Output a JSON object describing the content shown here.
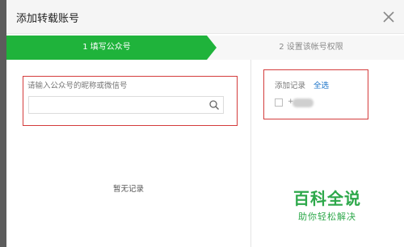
{
  "dialog": {
    "title": "添加转载账号",
    "close_icon": "close-icon"
  },
  "steps": [
    {
      "label": "1  填写公众号",
      "active": true
    },
    {
      "label": "2  设置该帐号权限",
      "active": false
    }
  ],
  "search": {
    "hint": "请输入公众号的昵称或微信号",
    "placeholder": "",
    "value": "",
    "icon": "search-icon"
  },
  "left_pane": {
    "empty_text": "暂无记录"
  },
  "records": {
    "title": "添加记录",
    "select_all": "全选",
    "items": [
      {
        "prefix": "+",
        "checked": false
      }
    ]
  },
  "watermark": {
    "main": "百科全说",
    "sub": "助你轻松解决"
  },
  "colors": {
    "active_step": "#1fb33b",
    "highlight": "#d43c3c",
    "link": "#1a73c8",
    "watermark": "#2da84a"
  }
}
